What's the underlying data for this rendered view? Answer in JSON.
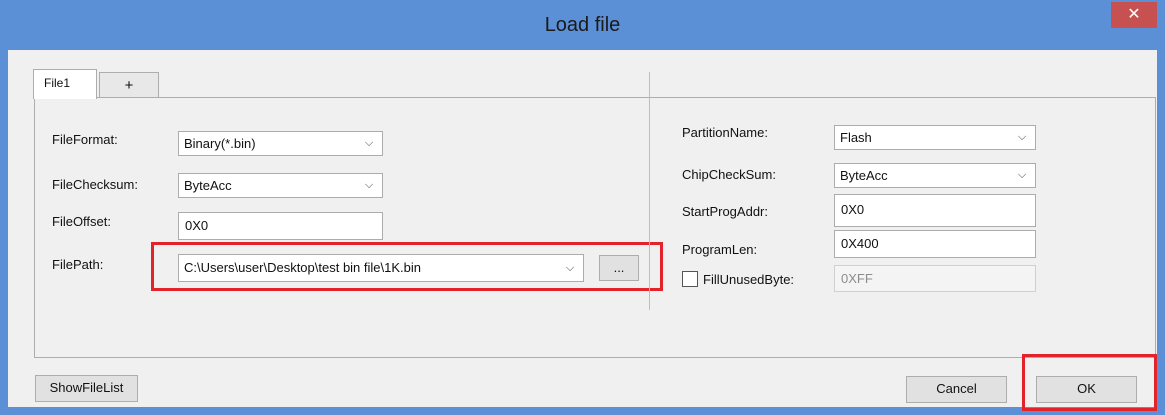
{
  "window": {
    "title": "Load file",
    "close_glyph": "✕",
    "titlebar_color": "#5b8fd6"
  },
  "tabs": [
    {
      "label": "File1",
      "active": true
    },
    {
      "label": "+",
      "active": false
    }
  ],
  "left": {
    "file_format": {
      "label": "FileFormat:",
      "value": "Binary(*.bin)"
    },
    "file_checksum": {
      "label": "FileChecksum:",
      "value": "ByteAcc"
    },
    "file_offset": {
      "label": "FileOffset:",
      "value": "0X0"
    },
    "file_path": {
      "label": "FilePath:",
      "value": "C:\\Users\\user\\Desktop\\test bin file\\1K.bin",
      "browse_label": "..."
    }
  },
  "right": {
    "partition_name": {
      "label": "PartitionName:",
      "value": "Flash"
    },
    "chip_checksum": {
      "label": "ChipCheckSum:",
      "value": "ByteAcc"
    },
    "start_prog_addr": {
      "label": "StartProgAddr:",
      "value": "0X0"
    },
    "program_len": {
      "label": "ProgramLen:",
      "value": "0X400"
    },
    "fill_unused_byte": {
      "label": "FillUnusedByte:",
      "value": "0XFF",
      "checked": false
    }
  },
  "footer": {
    "show_file_list": "ShowFileList",
    "cancel": "Cancel",
    "ok": "OK"
  },
  "colors": {
    "highlight": "#e2232a",
    "client_bg": "#f0f0f0"
  }
}
